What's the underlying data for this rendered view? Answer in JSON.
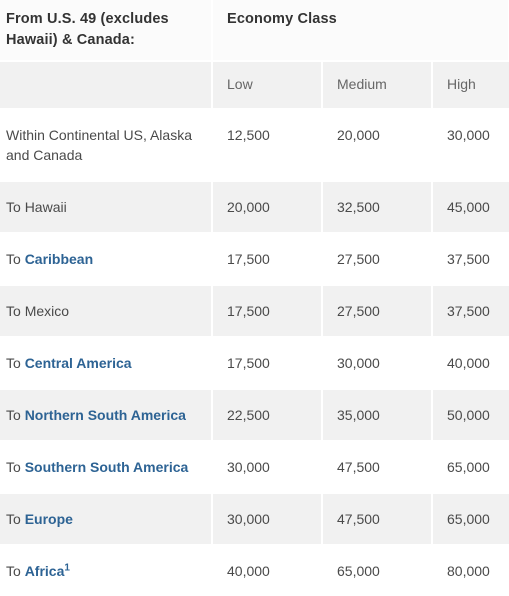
{
  "table": {
    "title_region": "From U.S. 49 (excludes Hawaii) & Canada:",
    "title_cabin": "Economy Class",
    "columns": {
      "region": "",
      "low": "Low",
      "medium": "Medium",
      "high": "High"
    },
    "colors": {
      "link": "#2d6394",
      "text": "#4a4a4a",
      "header_text": "#333333",
      "subheader_text": "#666666",
      "stripe": "#f1f1f1",
      "background": "#ffffff"
    },
    "rows": [
      {
        "prefix": "",
        "link": "",
        "plain": "Within Continental US, Alaska and Canada",
        "footnote": "",
        "low": "12,500",
        "medium": "20,000",
        "high": "30,000"
      },
      {
        "prefix": "To ",
        "link": "",
        "plain": "Hawaii",
        "footnote": "",
        "low": "20,000",
        "medium": "32,500",
        "high": "45,000"
      },
      {
        "prefix": "To ",
        "link": "Caribbean",
        "plain": "",
        "footnote": "",
        "low": "17,500",
        "medium": "27,500",
        "high": "37,500"
      },
      {
        "prefix": "To ",
        "link": "",
        "plain": "Mexico",
        "footnote": "",
        "low": "17,500",
        "medium": "27,500",
        "high": "37,500"
      },
      {
        "prefix": "To ",
        "link": "Central America",
        "plain": "",
        "footnote": "",
        "low": "17,500",
        "medium": "30,000",
        "high": "40,000"
      },
      {
        "prefix": "To ",
        "link": "Northern South America",
        "plain": "",
        "footnote": "",
        "low": "22,500",
        "medium": "35,000",
        "high": "50,000"
      },
      {
        "prefix": "To ",
        "link": "Southern South America",
        "plain": "",
        "footnote": "",
        "low": "30,000",
        "medium": "47,500",
        "high": "65,000"
      },
      {
        "prefix": "To ",
        "link": "Europe",
        "plain": "",
        "footnote": "",
        "low": "30,000",
        "medium": "47,500",
        "high": "65,000"
      },
      {
        "prefix": "To ",
        "link": "Africa",
        "plain": "",
        "footnote": "1",
        "low": "40,000",
        "medium": "65,000",
        "high": "80,000"
      }
    ]
  }
}
